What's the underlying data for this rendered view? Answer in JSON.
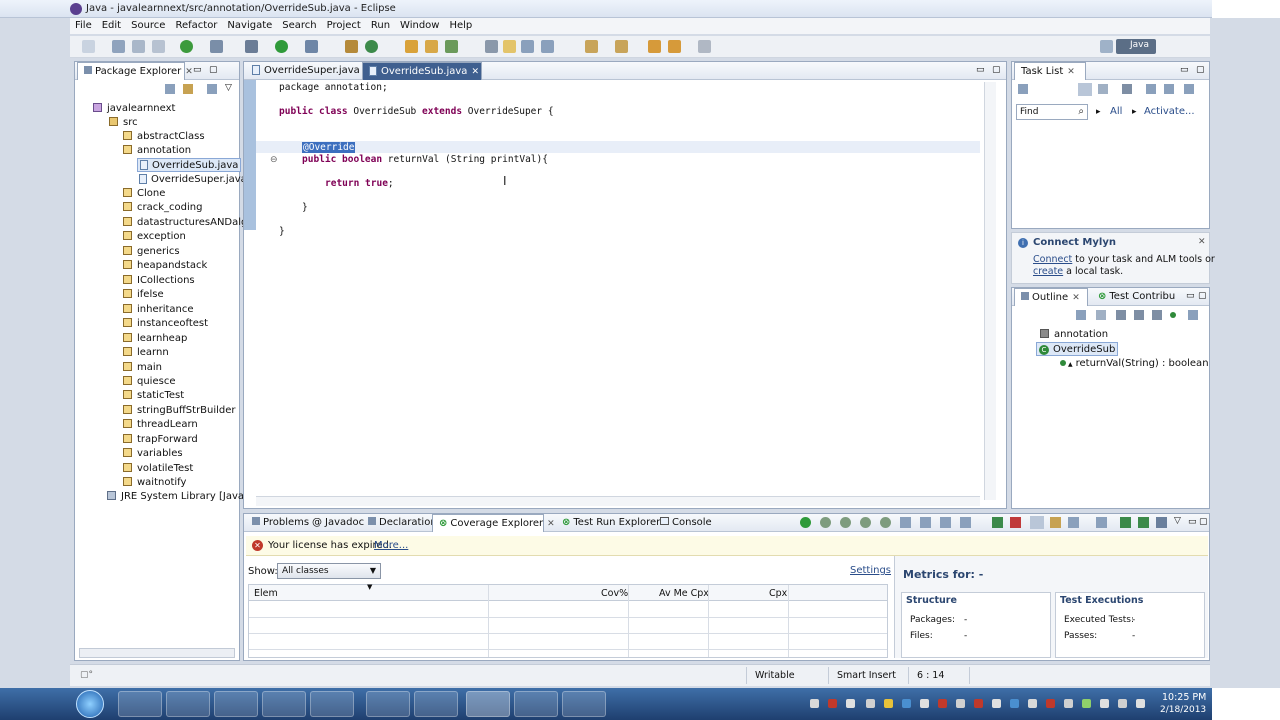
{
  "window": {
    "title": "Java - javalearnnext/src/annotation/OverrideSub.java - Eclipse"
  },
  "menu": [
    "File",
    "Edit",
    "Source",
    "Refactor",
    "Navigate",
    "Search",
    "Project",
    "Run",
    "Window",
    "Help"
  ],
  "perspective": {
    "label": "Java"
  },
  "package_explorer": {
    "tab": "Package Explorer",
    "project": "javalearnnext",
    "src": "src",
    "packages": [
      "abstractClass",
      "annotation",
      "Clone",
      "crack_coding",
      "datastructuresANDalgo",
      "exception",
      "generics",
      "heapandstack",
      "ICollections",
      "ifelse",
      "inheritance",
      "instanceoftest",
      "learnheap",
      "learnn",
      "main",
      "quiesce",
      "staticTest",
      "stringBuffStrBuilder",
      "threadLearn",
      "trapForward",
      "variables",
      "volatileTest",
      "waitnotify"
    ],
    "annotation_files": [
      "OverrideSub.java",
      "OverrideSuper.java"
    ],
    "jre": "JRE System Library [JavaSE-"
  },
  "editor": {
    "tabs": [
      "OverrideSuper.java",
      "OverrideSub.java"
    ],
    "lines": {
      "l1": "package annotation;",
      "l2_kw": "public class",
      "l2_rest": " OverrideSub ",
      "l2_kw2": "extends",
      "l2_end": " OverrideSuper {",
      "l3": "@Override",
      "l4_kw": "public boolean",
      "l4_rest": " returnVal (String printVal){",
      "l5_kw": "return true",
      "l5_end": ";",
      "l6": "}",
      "l7": "}"
    }
  },
  "task_list": {
    "tab": "Task List",
    "find_placeholder": "Find",
    "all": "All",
    "activate": "Activate..."
  },
  "mylyn": {
    "title": "Connect Mylyn",
    "connect": "Connect",
    "line1": " to your task and ALM tools or",
    "create": "create",
    "line2": " a local task."
  },
  "outline": {
    "tabs": [
      "Outline",
      "Test Contribu"
    ],
    "items": [
      "annotation",
      "OverrideSub",
      "returnVal(String) : boolean"
    ]
  },
  "bottom": {
    "tabs": [
      "Problems",
      "Javadoc",
      "Declaration",
      "Coverage Explorer",
      "Test Run Explorer",
      "Console"
    ],
    "license": "Your license has expired.",
    "more": "More...",
    "show_label": "Show:",
    "show_value": "All classes",
    "settings": "Settings",
    "columns": [
      "Elem",
      "Cov%",
      "Av Me Cpx",
      "Cpx"
    ],
    "metrics_title": "Metrics for: -",
    "structure": {
      "title": "Structure",
      "packages": "Packages:",
      "packages_val": "-",
      "files": "Files:",
      "files_val": "-"
    },
    "tests": {
      "title": "Test Executions",
      "executed": "Executed Tests:",
      "executed_val": "-",
      "passes": "Passes:",
      "passes_val": "-"
    }
  },
  "status": {
    "writable": "Writable",
    "insert": "Smart Insert",
    "position": "6 : 14"
  },
  "clock": {
    "time": "10:25 PM",
    "date": "2/18/2013"
  }
}
